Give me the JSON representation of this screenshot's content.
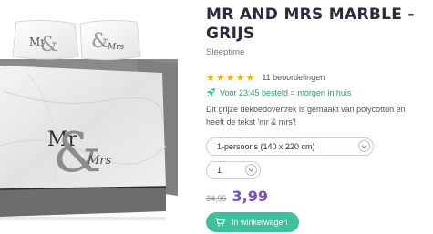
{
  "product": {
    "title": "MR AND MRS MARBLE - GRIJS",
    "brand": "Sleeptime",
    "stars": "★★★★★",
    "rating_count": "11 beoordelingen",
    "delivery": "Voor 23:45 besteld = morgen in huis",
    "description": "Dit grijze dekbedovertrek is gemaakt van polycotton en heeft de tekst 'mr & mrs'!",
    "size_option": "1-persoons (140 x 220 cm)",
    "quantity": "1",
    "price_old": "34,95",
    "price_new": "3,99",
    "cart_button": "In winkelwagen"
  },
  "colors": {
    "accent_purple": "#7b4fc9",
    "cart_green": "#3cc19a",
    "delivery_green": "#2f9a6e",
    "star_yellow": "#f4b400"
  }
}
